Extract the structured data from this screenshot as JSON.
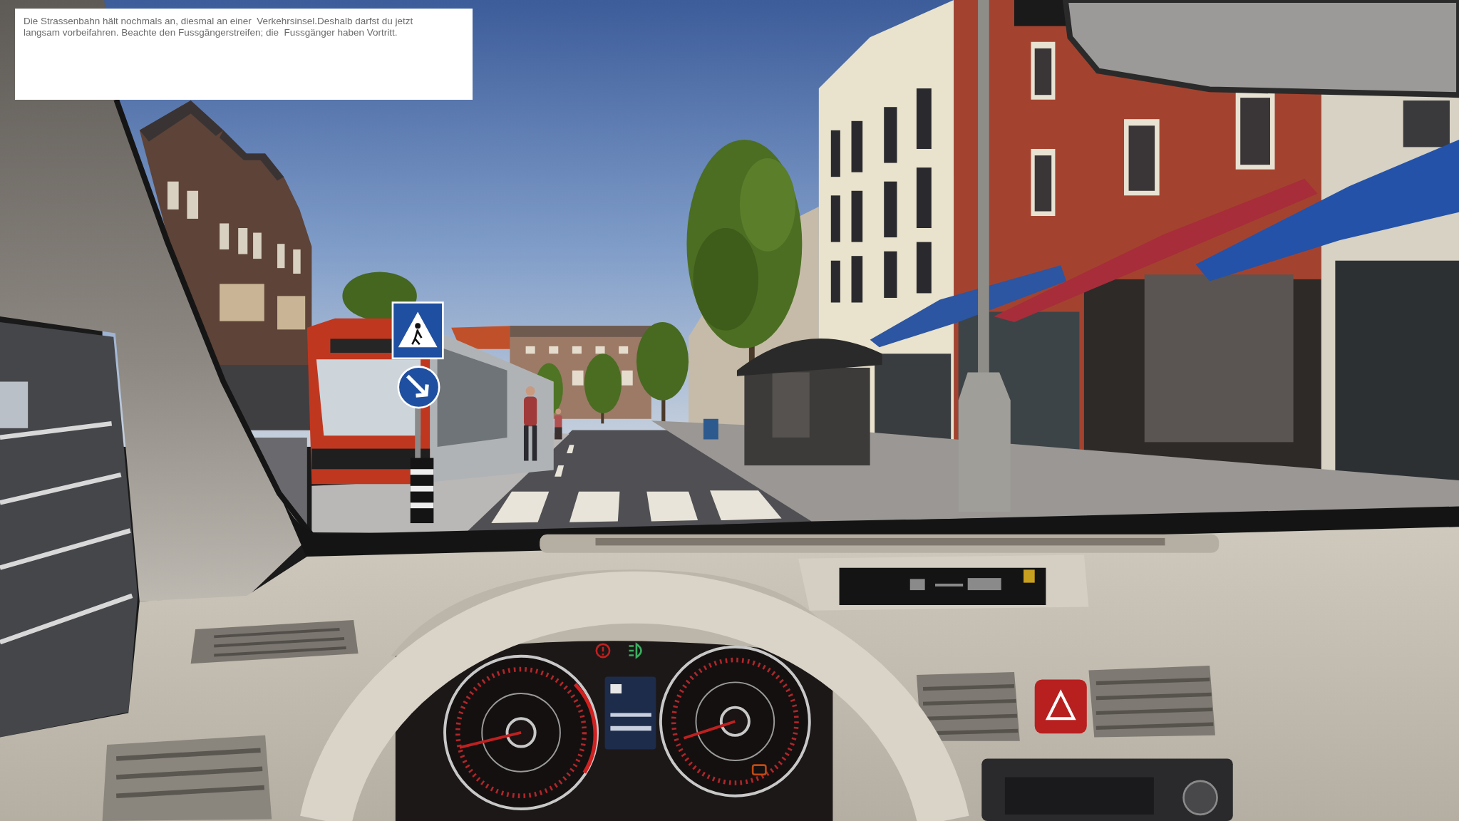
{
  "instruction_panel": {
    "text": "Die Strassenbahn hält nochmals an, diesmal an einer  Verkehrsinsel.Deshalb darfst du jetzt langsam vorbeifahren. Beachte den Fussgängerstreifen; die  Fussgänger haben Vortritt."
  }
}
